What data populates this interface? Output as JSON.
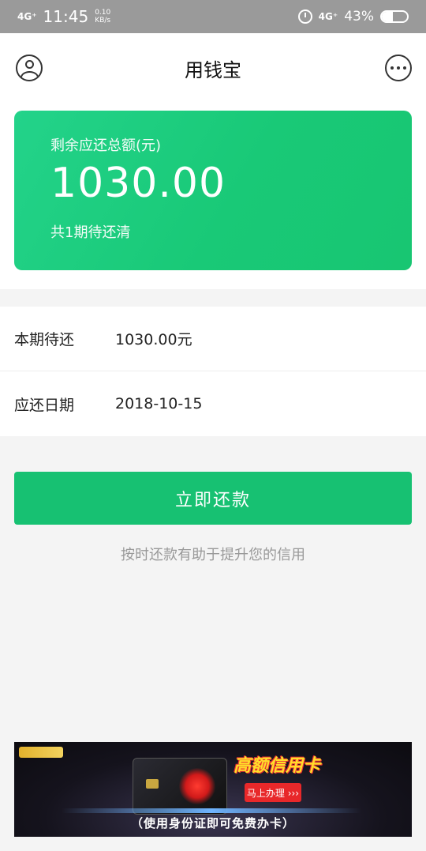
{
  "status_bar": {
    "network": "4G⁺",
    "time": "11:45",
    "speed_value": "0.10",
    "speed_unit": "KB/s",
    "network_right": "4G⁺",
    "battery_percent": "43%",
    "battery_level": 0.43
  },
  "nav": {
    "title": "用钱宝"
  },
  "summary": {
    "label": "剩余应还总额(元)",
    "amount": "1030.00",
    "periods": "共1期待还清"
  },
  "info": [
    {
      "label": "本期待还",
      "value": "1030.00元"
    },
    {
      "label": "应还日期",
      "value": "2018-10-15"
    }
  ],
  "actions": {
    "repay_label": "立即还款",
    "hint": "按时还款有助于提升您的信用"
  },
  "ad": {
    "title": "高额信用卡",
    "cta": "马上办理 ›››",
    "footer": "（使用身份证即可免费办卡）"
  },
  "colors": {
    "accent": "#17c172",
    "card_green": "#1fcd80",
    "status_bar": "#9a9a9a"
  }
}
